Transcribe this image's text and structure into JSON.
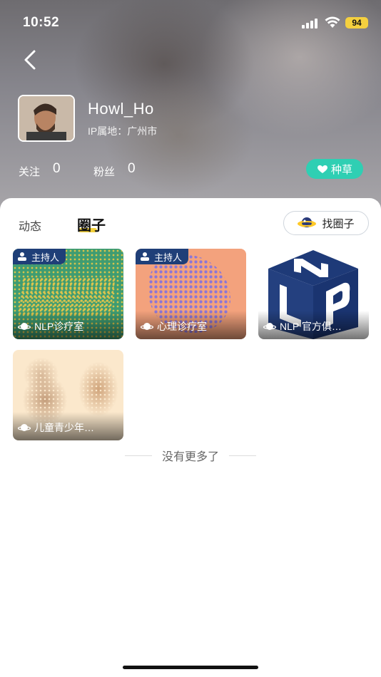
{
  "status_bar": {
    "time": "10:52",
    "battery": "94"
  },
  "profile": {
    "username": "Howl_Ho",
    "ip_location": "IP属地：广州市",
    "following_label": "关注",
    "following_count": "0",
    "followers_label": "粉丝",
    "followers_count": "0",
    "zhongcao_label": "种草"
  },
  "tabs": {
    "dongtai": "动态",
    "quanzi": "圈子"
  },
  "find_circle_label": "找圈子",
  "host_badge_label": "主持人",
  "circles": [
    {
      "name": "NLP诊疗室",
      "host": true
    },
    {
      "name": "心理诊疗室",
      "host": true
    },
    {
      "name": "NLP 官方俱…",
      "host": false
    },
    {
      "name": "儿童青少年…",
      "host": false
    }
  ],
  "no_more_text": "没有更多了",
  "colors": {
    "accent_teal": "#2fcfb3",
    "tab_underline": "#f2cf3a",
    "badge_navy": "#1f3f78"
  }
}
